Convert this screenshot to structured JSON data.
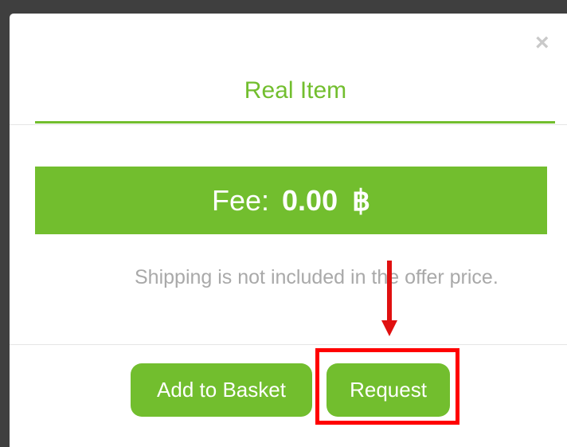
{
  "modal": {
    "close_glyph": "×",
    "title": "Real Item",
    "fee": {
      "label": "Fee:",
      "amount": "0.00",
      "currency": "฿"
    },
    "shipping_note": "Shipping is not included in the offer price.",
    "buttons": {
      "add_to_basket": "Add to Basket",
      "request": "Request"
    }
  },
  "colors": {
    "accent": "#72be2e",
    "annotation": "#ff0000"
  }
}
